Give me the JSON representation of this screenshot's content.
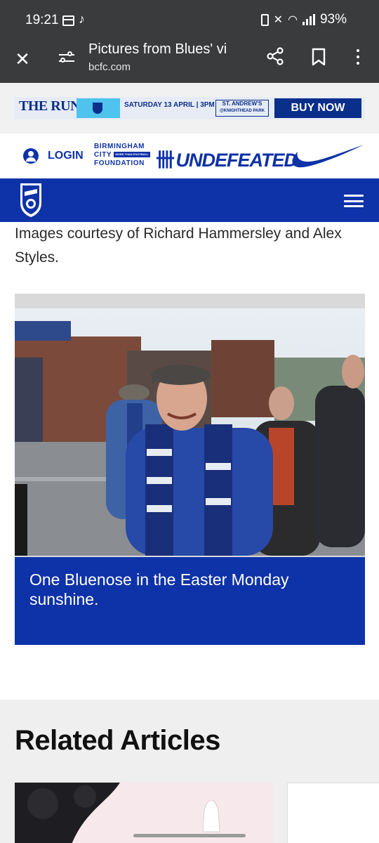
{
  "status_bar": {
    "time": "19:21",
    "battery": "93%"
  },
  "browser": {
    "title": "Pictures from Blues' vi",
    "domain": "bcfc.com"
  },
  "ad": {
    "headline": "THE RUN-IN",
    "date_text": "SATURDAY 13 APRIL | 3PM",
    "stadium_line1": "ST. ANDREW'S",
    "stadium_line2": "@KNIGHTHEAD PARK",
    "cta": "BUY NOW"
  },
  "sponsors": {
    "login": "LOGIN",
    "foundation_line1": "BIRMINGHAM",
    "foundation_line2": "CITY",
    "foundation_line3": "FOUNDATION",
    "foundation_tag": "MORE THAN FOOTBALL",
    "undefeated": "UNDEFEATED"
  },
  "article": {
    "intro": "Images courtesy of Richard Hammersley and Alex Styles.",
    "caption": "One Bluenose in the Easter Monday sunshine."
  },
  "related": {
    "title": "Related Articles"
  },
  "colors": {
    "brand_blue": "#0e32a8",
    "browser_chrome": "#3a3b3d"
  }
}
